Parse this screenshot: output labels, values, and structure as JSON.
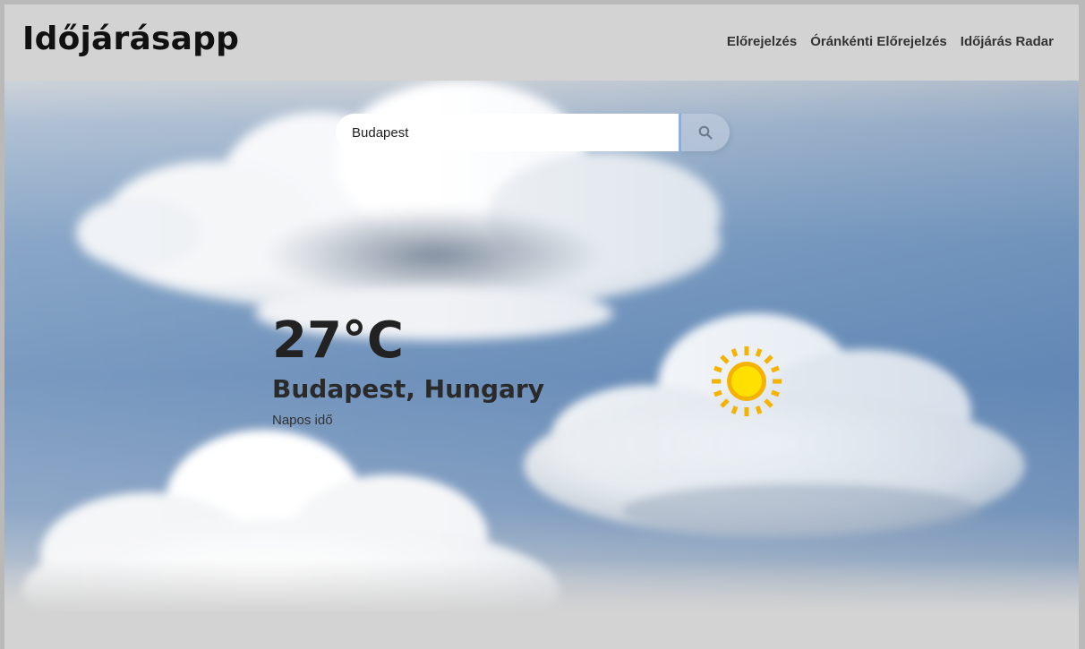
{
  "app": {
    "title": "Időjárásapp"
  },
  "nav": {
    "items": [
      {
        "label": "Előrejelzés"
      },
      {
        "label": "Óránkénti Előrejelzés"
      },
      {
        "label": "Időjárás Radar"
      }
    ]
  },
  "search": {
    "value": "Budapest",
    "button_icon": "search-icon"
  },
  "weather": {
    "temperature": "27°C",
    "location": "Budapest, Hungary",
    "description": "Napos idő",
    "icon": "sun-icon"
  },
  "colors": {
    "sky": "#6e91bb",
    "header": "#d3d3d3",
    "sun": "#ffd600",
    "sun_rays": "#f5b301"
  }
}
